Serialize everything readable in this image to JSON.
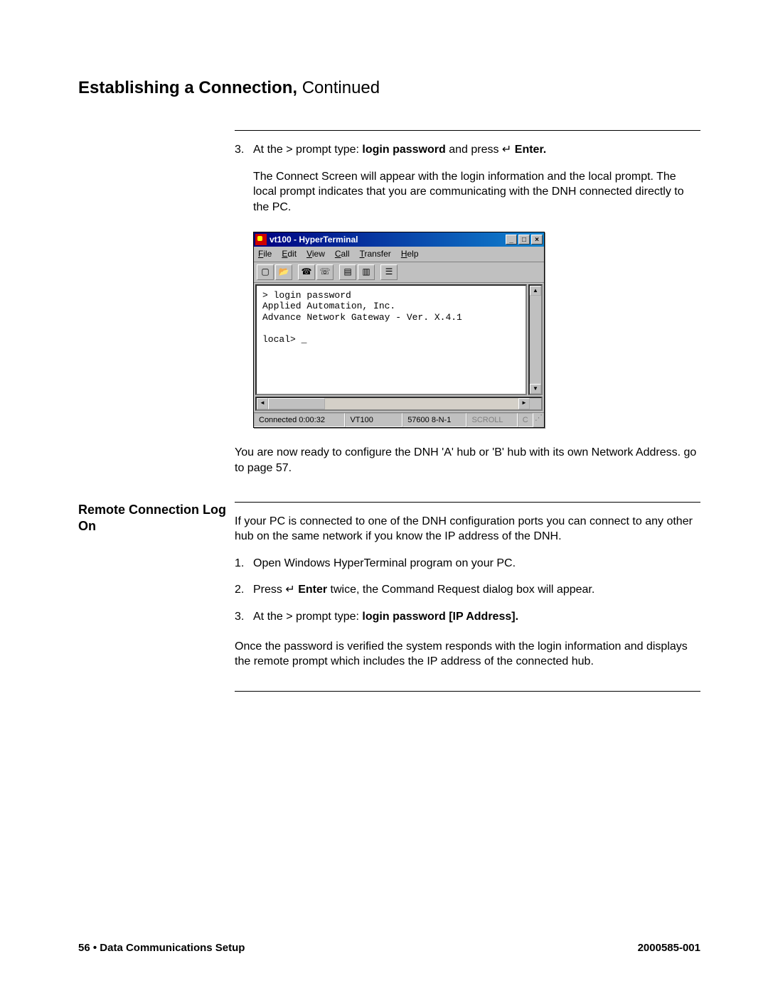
{
  "page": {
    "title_bold": "Establishing a Connection, ",
    "title_cont": "Continued"
  },
  "section1": {
    "step_num": "3.",
    "step_pre": "At the > prompt type: ",
    "step_bold1": "login password",
    "step_mid": " and press ",
    "step_enter_sym": "↵",
    "step_enter": " Enter.",
    "para2": "The Connect Screen will appear with the login information and the local prompt. The local prompt indicates that you are communicating with the DNH connected directly to the PC.",
    "after_img": "You are now ready to configure the DNH 'A' hub or 'B' hub with its own Network Address. go to page 57."
  },
  "ht": {
    "title": "vt100 - HyperTerminal",
    "menu": [
      "File",
      "Edit",
      "View",
      "Call",
      "Transfer",
      "Help"
    ],
    "term_line1": "> login password",
    "term_line2": "Applied Automation, Inc.",
    "term_line3": "Advance Network Gateway - Ver. X.4.1",
    "term_blank": "",
    "term_line4": "local> _",
    "status": {
      "conn": "Connected 0:00:32",
      "emul": "VT100",
      "baud": "57600 8-N-1",
      "scroll": "SCROLL",
      "c": "C"
    }
  },
  "section2": {
    "heading": "Remote Connection Log On",
    "intro": "If your PC is connected to one of the DNH configuration ports you can connect to any other hub on the same network if you know the IP address of the DNH.",
    "s1_num": "1.",
    "s1": "Open Windows HyperTerminal program on your PC.",
    "s2_num": "2.",
    "s2_pre": "Press ",
    "s2_sym": "↵",
    "s2_bold": " Enter",
    "s2_post": " twice, the Command Request dialog box will appear.",
    "s3_num": "3.",
    "s3_pre": "At the > prompt type: ",
    "s3_bold": "login password [IP Address].",
    "closing": "Once the password is verified the system responds with the login information and displays the remote prompt which includes the IP address of the connected hub."
  },
  "footer": {
    "left_page": "56",
    "left_bullet": "  •  ",
    "left_title": "Data Communications Setup",
    "right": "2000585-001"
  }
}
